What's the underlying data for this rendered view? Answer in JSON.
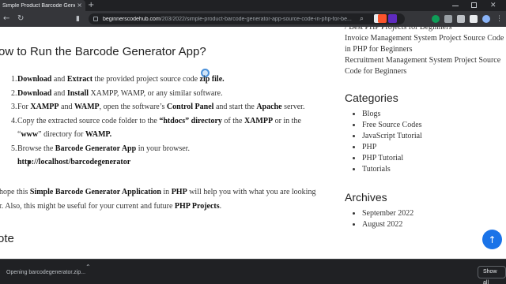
{
  "tab": {
    "title": "Simple Product Barcode Generato",
    "close": "×",
    "new_tab": "+"
  },
  "address_bar": {
    "host": "beginnerscodehub.com",
    "path": "/203/2022/simple-product-barcode-generator-app-source-code-in-php-for-be..."
  },
  "article": {
    "heading": "ow to Run the Barcode Generator App?",
    "steps": [
      {
        "num": "1.",
        "parts": [
          "Download",
          " and ",
          "Extract",
          " the provided project source code ",
          "zip file."
        ]
      },
      {
        "num": "2.",
        "parts": [
          "Download",
          " and ",
          "Install",
          " XAMPP, WAMP, or any similar software."
        ]
      },
      {
        "num": "3.",
        "parts": [
          "For ",
          "XAMPP",
          " and ",
          "WAMP",
          ", open the software’s ",
          "Control Panel",
          " and start the ",
          "Apache",
          " server."
        ]
      },
      {
        "num": "4.",
        "line1": "Copy the extracted source code folder to the ",
        "line1_b1": "“htdocs” directory",
        "line1_mid": " of the ",
        "line1_b2": "XAMPP",
        "line1_end": " or in the",
        "line2": "“",
        "line2_b": "www",
        "line2_mid": "” directory for ",
        "line2_b2": "WAMP."
      },
      {
        "num": "5.",
        "parts": [
          "Browse the ",
          "Barcode Generator App",
          " in your browser."
        ]
      }
    ],
    "sub_link": "http://localhost/barcodegenerator",
    "para": {
      "a": "hope this ",
      "b": "Simple Barcode Generator Application",
      "c": " in ",
      "d": "PHP",
      "e": " will help you with what you are looking",
      "f": "r. Also, this might be useful for your current and future ",
      "g": "PHP Projects",
      "h": "."
    },
    "note_heading": "ote"
  },
  "sidebar": {
    "recent_links": [
      "/ Best PHP Projects for Beginners",
      "Invoice Management System Project Source Code in PHP for Beginners",
      "Recruitment Management System Project Source Code for Beginners"
    ],
    "categories_title": "Categories",
    "categories": [
      "Blogs",
      "Free Source Codes",
      "JavaScript Tutorial",
      "PHP",
      "PHP Tutorial",
      "Tutorials"
    ],
    "archives_title": "Archives",
    "archives": [
      "September 2022",
      "August 2022"
    ]
  },
  "download_bar": {
    "item": "Opening barcodegenerator.zip...",
    "show_all": "Show all"
  },
  "colors": {
    "accent": "#1a73e8",
    "chrome_dark": "#202124",
    "chrome_mid": "#35363a"
  }
}
